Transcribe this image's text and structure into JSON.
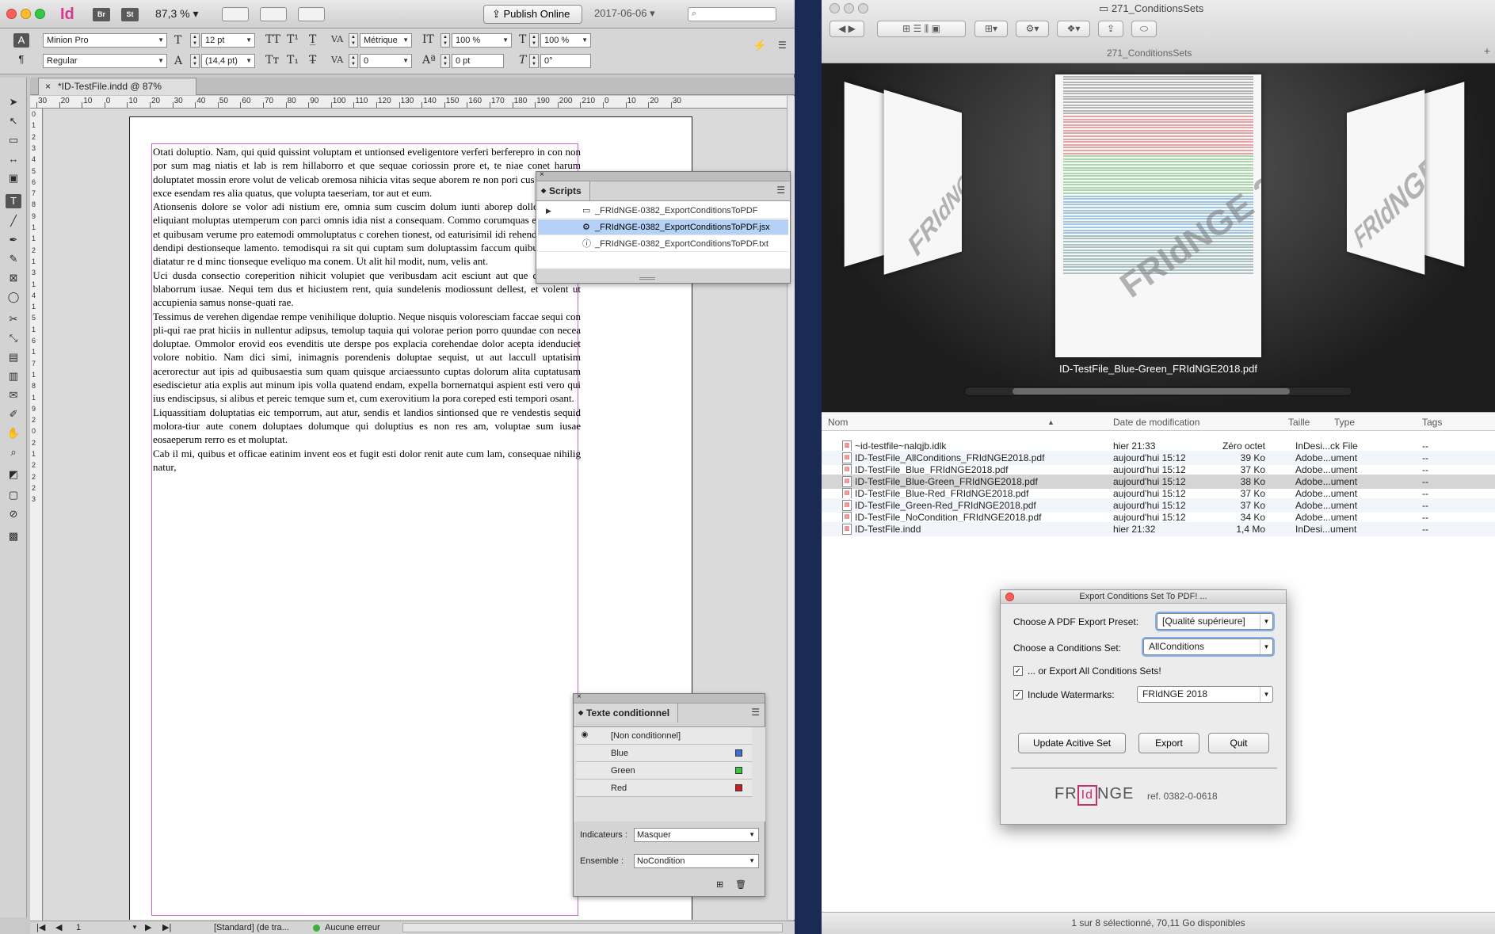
{
  "indesign": {
    "zoom": "87,3 %",
    "publish_label": "Publish Online",
    "date": "2017-06-06",
    "mini_apps": [
      "Br",
      "St"
    ],
    "control": {
      "font_family": "Minion Pro",
      "font_style": "Regular",
      "font_size": "12 pt",
      "leading": "(14,4 pt)",
      "kerning": "Métrique",
      "tracking": "0",
      "vscale": "100 %",
      "hscale": "100 %",
      "baseline": "0 pt",
      "skew": "0°"
    },
    "doc_tab": "*ID-TestFile.indd @ 87%",
    "ruler_h": [
      "30",
      "20",
      "10",
      "0",
      "10",
      "20",
      "30",
      "40",
      "50",
      "60",
      "70",
      "80",
      "90",
      "100",
      "110",
      "120",
      "130",
      "140",
      "150",
      "160",
      "170",
      "180",
      "190",
      "200",
      "210",
      "0",
      "10",
      "20",
      "30"
    ],
    "ruler_v": [
      "0",
      "1",
      "2",
      "3",
      "4",
      "5",
      "6",
      "7",
      "8",
      "9",
      "1",
      "1",
      "2",
      "1",
      "3",
      "1",
      "4",
      "1",
      "5",
      "1",
      "6",
      "1",
      "7",
      "1",
      "8",
      "1",
      "9",
      "2",
      "0",
      "2",
      "1",
      "2",
      "2",
      "2",
      "3"
    ],
    "paragraphs": [
      "Otati doluptio. Nam, qui quid quissint voluptam et untionsed eveligentore verferi berferepro in con non por sum mag niatis et lab is rem hillaborro et que sequae coriossin prore et, te niae conet harum doluptatet mossin erore volut de velicab oremosa nihicia vitas seque aborem re non pori cus vendicitiat exce esendam res alia quatus, que volupta taeseriam, tor aut et eum.",
      "Ationsenis dolore se volor adi nistium ere, omnia sum cuscim dolum iunti aborep dollor sum vel eliquiant moluptas utemperum con parci omnis idia nist a consequam. Commo corumquas et el illatius et quibusam verume pro eatemodi ommoluptatus c corehen tionest, od eaturisimil idi rehendio. Et pore dendipi destionseque lamento. temodisqui ra sit qui cuptam sum doluptassim faccum quibusc ipsaepe diatatur re d minc tionseque eveliquo ma conem. Ut alit hil modit, num, velis ant.",
      "Uci dusda consectio coreperition nihicit volupiet que veribusdam acit esciunt aut que qui sape si blaborrum iusae. Nequi tem dus et hiciustem rent, quia sundelenis modiossunt dellest, et volent ut accupienia samus nonse-quati rae.",
      "Tessimus de verehen digendae rempe venihilique doluptio. Neque nisquis voloresciam faccae sequi con pli-qui rae prat hiciis in nullentur adipsus, temolup taquia qui volorae perion porro quundae con necea doluptae. Ommolor erovid eos evenditis ute derspe pos explacia corehendae dolor acepta idenduciet volore nobitio. Nam dici simi, inimagnis porendenis doluptae sequist, ut aut laccull uptatisim acerorectur aut ipis ad quibusaestia sum quam quisque arciaessunto cuptas dolorum alita cuptatusam esediscietur atia explis aut minum ipis volla quatend endam, expella bornernatqui aspient esti vero qui ius endiscipsus, si alibus et pereic temque sum et, cum exerovitium la pora coreped esti tempori osant.",
      "Liquassitiam doluptatias eic temporrum, aut atur, sendis et landios sintionsed que re vendestis sequid molora-tiur aute conem doluptaes dolumque qui doluptius es non res am, voluptae sum iusae eosaeperum rerro es et moluptat.",
      "Cab il mi, quibus et officae eatinim invent eos et fugit esti dolor renit aute cum lam, consequae nihilig natur,"
    ],
    "scripts_panel": {
      "title": "Scripts",
      "items": [
        {
          "label": "_FRIdNGE-0382_ExportConditionsToPDF",
          "icon": "folder-icon"
        },
        {
          "label": "_FRIdNGE-0382_ExportConditionsToPDF.jsx",
          "icon": "script-icon"
        },
        {
          "label": "_FRIdNGE-0382_ExportConditionsToPDF.txt",
          "icon": "info-icon"
        }
      ]
    },
    "conditions_panel": {
      "title": "Texte conditionnel",
      "rows": [
        {
          "label": "[Non conditionnel]",
          "color": ""
        },
        {
          "label": "Blue",
          "color": "#3a6fd8"
        },
        {
          "label": "Green",
          "color": "#3bc43b"
        },
        {
          "label": "Red",
          "color": "#d01b1b"
        }
      ],
      "indicators_label": "Indicateurs :",
      "indicators_value": "Masquer",
      "set_label": "Ensemble :",
      "set_value": "NoCondition"
    },
    "status": {
      "page": "1",
      "style": "[Standard] (de tra...",
      "preflight": "Aucune erreur"
    }
  },
  "finder": {
    "folder_title": "271_ConditionsSets",
    "subtitle": "271_ConditionsSets",
    "preview_caption": "ID-TestFile_Blue-Green_FRIdNGE2018.pdf",
    "watermark": "FRIdNGE 2018",
    "columns": {
      "name": "Nom",
      "date": "Date de modification",
      "size": "Taille",
      "type": "Type",
      "tags": "Tags"
    },
    "files": [
      {
        "name": "~id-testfile~nalqjb.idlk",
        "date": "hier 21:33",
        "size": "Zéro octet",
        "type": "InDesi...ck File",
        "tags": "--"
      },
      {
        "name": "ID-TestFile_AllConditions_FRIdNGE2018.pdf",
        "date": "aujourd'hui 15:12",
        "size": "39 Ko",
        "type": "Adobe...ument",
        "tags": "--"
      },
      {
        "name": "ID-TestFile_Blue_FRIdNGE2018.pdf",
        "date": "aujourd'hui 15:12",
        "size": "37 Ko",
        "type": "Adobe...ument",
        "tags": "--"
      },
      {
        "name": "ID-TestFile_Blue-Green_FRIdNGE2018.pdf",
        "date": "aujourd'hui 15:12",
        "size": "38 Ko",
        "type": "Adobe...ument",
        "tags": "--"
      },
      {
        "name": "ID-TestFile_Blue-Red_FRIdNGE2018.pdf",
        "date": "aujourd'hui 15:12",
        "size": "37 Ko",
        "type": "Adobe...ument",
        "tags": "--"
      },
      {
        "name": "ID-TestFile_Green-Red_FRIdNGE2018.pdf",
        "date": "aujourd'hui 15:12",
        "size": "37 Ko",
        "type": "Adobe...ument",
        "tags": "--"
      },
      {
        "name": "ID-TestFile_NoCondition_FRIdNGE2018.pdf",
        "date": "aujourd'hui 15:12",
        "size": "34 Ko",
        "type": "Adobe...ument",
        "tags": "--"
      },
      {
        "name": "ID-TestFile.indd",
        "date": "hier 21:32",
        "size": "1,4 Mo",
        "type": "InDesi...ument",
        "tags": "--"
      }
    ],
    "status": "1 sur 8 sélectionné, 70,11 Go disponibles"
  },
  "dialog": {
    "title": "Export Conditions Set To PDF! ...",
    "preset_label": "Choose A PDF Export Preset:",
    "preset_value": "[Qualité supérieure]",
    "cond_label": "Choose a Conditions Set:",
    "cond_value": "AllConditions",
    "export_all_label": "... or Export All Conditions Sets!",
    "watermark_label": "Include Watermarks:",
    "watermark_value": "FRIdNGE 2018",
    "btn_update": "Update Acitive Set",
    "btn_export": "Export",
    "btn_quit": "Quit",
    "logo_left": "FR",
    "logo_mid": "Id",
    "logo_right": "NGE",
    "ref": "ref. 0382-0-0618"
  }
}
